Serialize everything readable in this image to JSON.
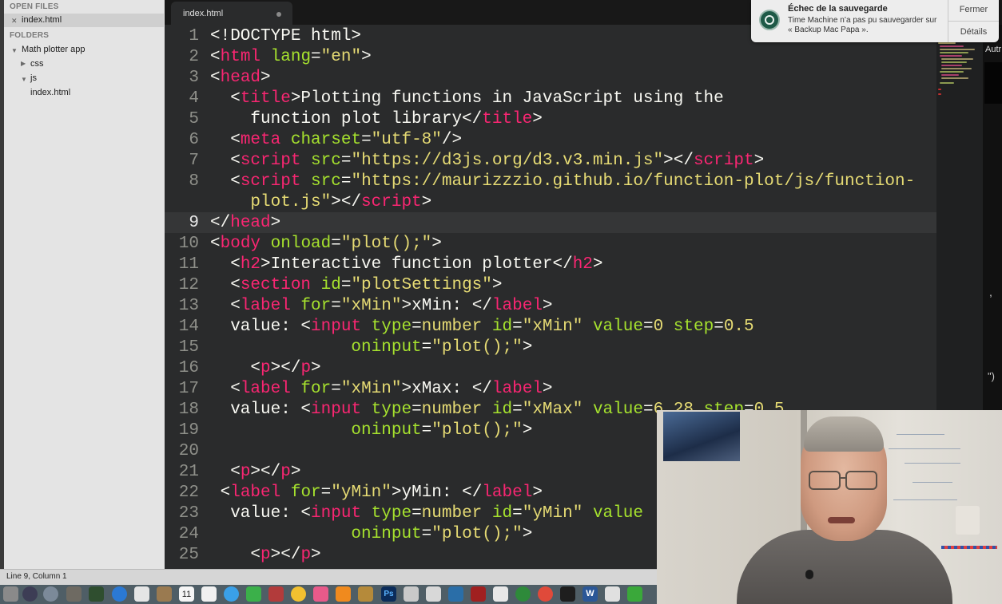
{
  "sidebar": {
    "open_files_header": "OPEN FILES",
    "open_file": "index.html",
    "folders_header": "FOLDERS",
    "project": "Math plotter app",
    "items": [
      "css",
      "js",
      "index.html"
    ]
  },
  "tab": {
    "label": "index.html"
  },
  "editor": {
    "line_numbers": [
      "1",
      "2",
      "3",
      "4",
      "5",
      "6",
      "7",
      "8",
      "9",
      "10",
      "11",
      "12",
      "13",
      "14",
      "15",
      "16",
      "17",
      "18",
      "19",
      "20",
      "21",
      "22",
      "23",
      "24",
      "25"
    ],
    "current_line": "9"
  },
  "notification": {
    "title": "Échec de la sauvegarde",
    "body": "Time Machine n’a pas pu sauvegarder sur « Backup Mac Papa ».",
    "close_label": "Fermer",
    "details_label": "Détails"
  },
  "right_panel": {
    "text": "Autr"
  },
  "status": {
    "position": "Line 9, Column 1"
  },
  "dock": {
    "calendar_day": "11"
  }
}
